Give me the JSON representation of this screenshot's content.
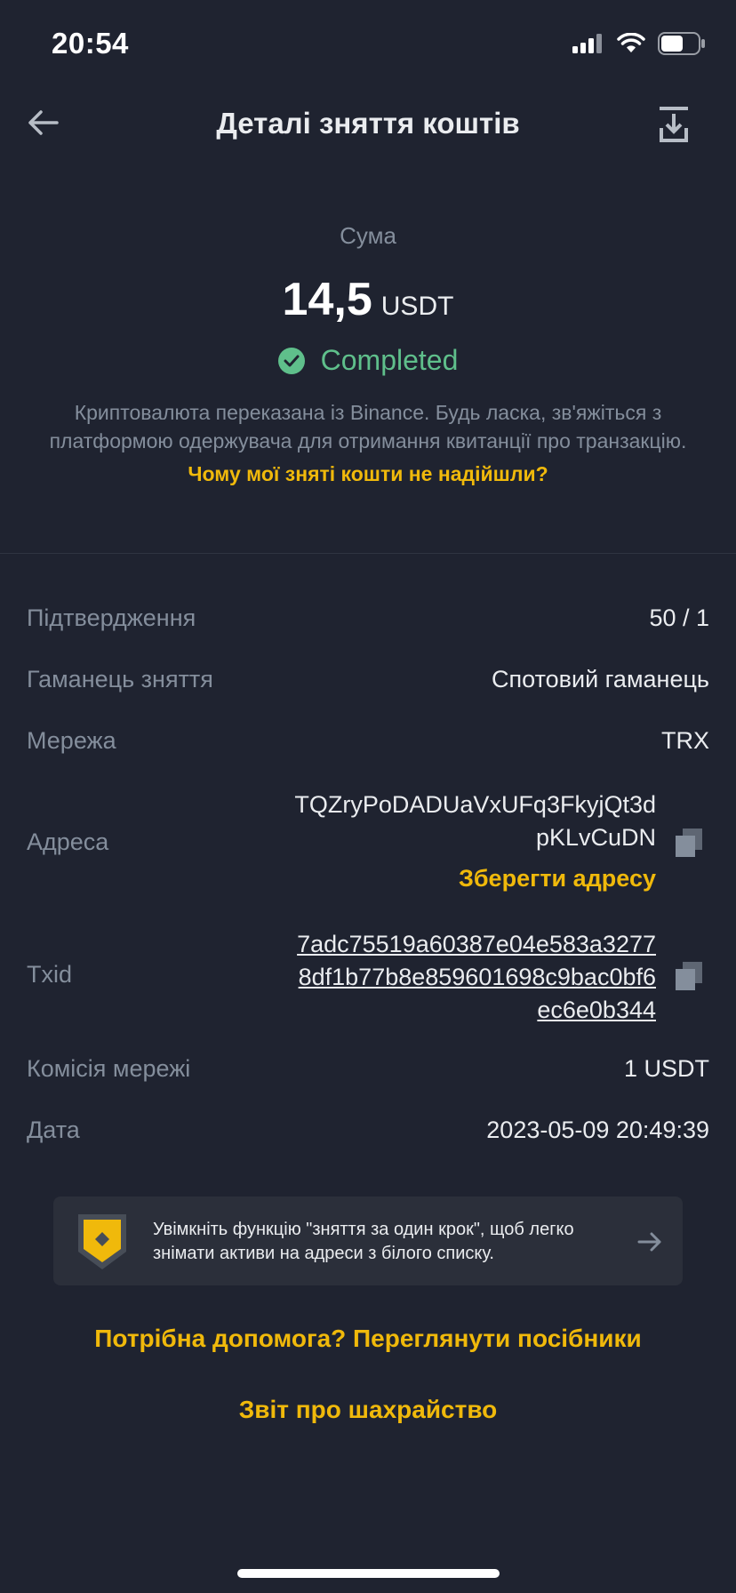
{
  "status_bar": {
    "time": "20:54"
  },
  "nav": {
    "title": "Деталі зняття коштів"
  },
  "summary": {
    "amount_label": "Сума",
    "amount": "14,5",
    "currency": "USDT",
    "status": "Completed",
    "info": "Криптовалюта переказана із Binance. Будь ласка, зв'яжіться з платформою одержувача для отримання квитанції про транзакцію.",
    "help_link": "Чому мої зняті кошти не надійшли?"
  },
  "details": {
    "confirmations_label": "Підтвердження",
    "confirmations_value": "50 / 1",
    "wallet_label": "Гаманець зняття",
    "wallet_value": "Спотовий гаманець",
    "network_label": "Мережа",
    "network_value": "TRX",
    "address_label": "Адреса",
    "address_line1": "TQZryPoDADUaVxUFq3FkyjQt3d",
    "address_line2": "pKLvCuDN",
    "save_address": "Зберегти адресу",
    "txid_label": "Txid",
    "txid_line1": "7adc75519a60387e04e583a3277",
    "txid_line2": "8df1b77b8e859601698c9bac0bf6",
    "txid_line3": "ec6e0b344",
    "fee_label": "Комісія мережі",
    "fee_value": "1 USDT",
    "date_label": "Дата",
    "date_value": "2023-05-09 20:49:39"
  },
  "banner": {
    "text": "Увімкніть функцію \"зняття за один крок\", щоб легко знімати активи на адреси з білого списку."
  },
  "links": {
    "help": "Потрібна допомога? Переглянути посібники",
    "fraud": "Звіт про шахрайство"
  },
  "colors": {
    "background": "#1f2330",
    "accent": "#f0b90b",
    "success": "#5fbf8b",
    "muted": "#848e9c"
  }
}
